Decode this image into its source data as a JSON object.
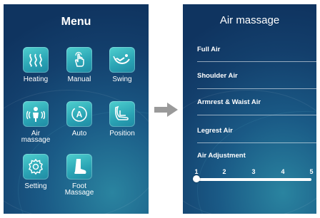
{
  "menu": {
    "title": "Menu",
    "items": [
      {
        "label": "Heating",
        "icon": "heating-icon"
      },
      {
        "label": "Manual",
        "icon": "hand-icon"
      },
      {
        "label": "Swing",
        "icon": "swing-icon"
      },
      {
        "label": "Air massage",
        "icon": "air-massage-icon"
      },
      {
        "label": "Auto",
        "icon": "auto-icon"
      },
      {
        "label": "Position",
        "icon": "position-icon"
      },
      {
        "label": "Setting",
        "icon": "gear-icon"
      },
      {
        "label": "Foot Massage",
        "icon": "foot-icon"
      }
    ]
  },
  "air_massage": {
    "title": "Air massage",
    "items": [
      "Full Air",
      "Shoulder Air",
      "Armrest & Waist Air",
      "Legrest Air"
    ],
    "adjustment_label": "Air Adjustment",
    "scale": [
      "1",
      "2",
      "3",
      "4",
      "5"
    ],
    "level": 1
  },
  "colors": {
    "panel_dark": "#133f6c",
    "panel_light": "#2a84a0",
    "icon_teal": "#3bbfc4",
    "arrow_gray": "#9a9a9a"
  }
}
